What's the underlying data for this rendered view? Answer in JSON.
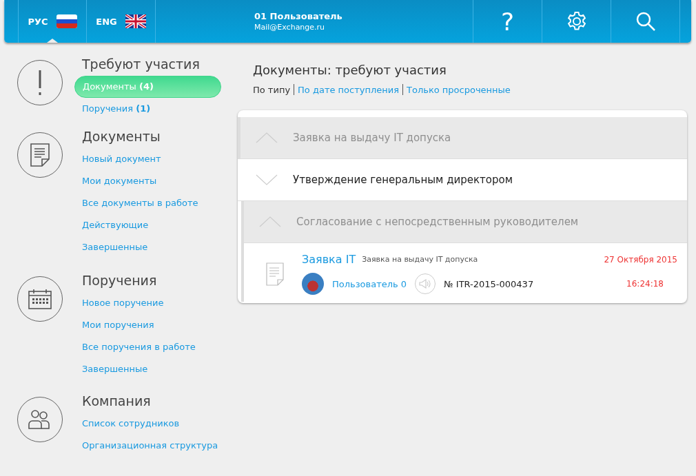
{
  "header": {
    "languages": [
      {
        "code": "РУС",
        "kind": "ru",
        "selected": true
      },
      {
        "code": "ENG",
        "kind": "uk",
        "selected": false
      }
    ],
    "user": {
      "name": "01 Пользователь",
      "email": "Mail@Exchange.ru"
    },
    "actions": [
      {
        "kind": "help",
        "label": "?"
      },
      {
        "kind": "settings"
      },
      {
        "kind": "search"
      }
    ]
  },
  "sidebar": [
    {
      "kind": "alert",
      "title": "Требуют участия",
      "items": [
        {
          "label": "Документы **(4)**",
          "selected": true
        },
        {
          "label": "Поручения **(1)**",
          "selected": false
        }
      ]
    },
    {
      "kind": "document",
      "title": "Документы",
      "items": [
        {
          "label": "Новый документ",
          "selected": false
        },
        {
          "label": "Мои документы",
          "selected": false
        },
        {
          "label": "Все документы в работе",
          "selected": false
        },
        {
          "label": "Действующие",
          "selected": false
        },
        {
          "label": "Завершенные",
          "selected": false
        }
      ]
    },
    {
      "kind": "calendar",
      "title": "Поручения",
      "items": [
        {
          "label": "Новое поручение",
          "selected": false
        },
        {
          "label": "Мои поручения",
          "selected": false
        },
        {
          "label": "Все поручения в работе",
          "selected": false
        },
        {
          "label": "Завершенные",
          "selected": false
        }
      ]
    },
    {
      "kind": "people",
      "title": "Компания",
      "items": [
        {
          "label": "Список сотрудников",
          "selected": false
        },
        {
          "label": "Организационная структура",
          "selected": false
        }
      ]
    }
  ],
  "main": {
    "title": "Документы: требуют участия",
    "filters": [
      {
        "label": "По типу",
        "selected": true
      },
      {
        "label": "По дате поступления",
        "selected": false
      },
      {
        "label": "Только просроченные",
        "selected": false
      }
    ],
    "groups": [
      {
        "title": "Заявка на выдачу IT допуска",
        "expanded": true,
        "children": [
          {
            "title": "Утверждение генеральным директором",
            "expanded": false
          },
          {
            "title": "Согласование с непосредственным руководителем",
            "expanded": true,
            "documents": [
              {
                "type": "Заявка IT",
                "description": "Заявка на выдачу IT допуска",
                "author": "Пользователь 0",
                "number": "№ ITR-2015-000437",
                "date": "27 Октября 2015",
                "time": "16:24:18"
              }
            ]
          }
        ]
      }
    ]
  }
}
